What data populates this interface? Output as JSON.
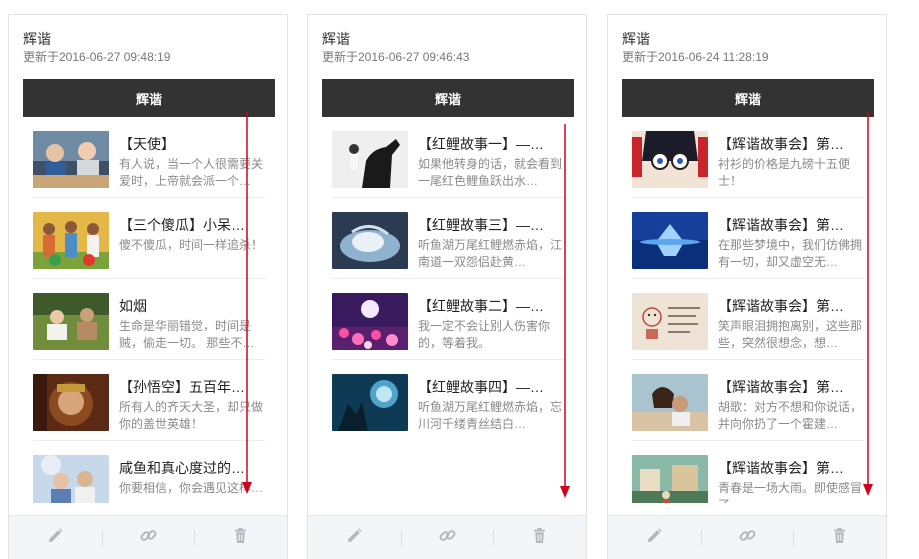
{
  "cards": [
    {
      "title": "辉谐",
      "updated": "更新于2016-06-27 09:48:19",
      "cover_title": "辉谐",
      "articles": [
        {
          "title": "【天使】",
          "desc": "有人说，当一个人很需要关爱时，上帝就会派一个…"
        },
        {
          "title": "【三个傻瓜】小呆…",
          "desc": "傻不傻瓜，时间一样追杀！"
        },
        {
          "title": "如烟",
          "desc": "生命是华丽错觉，时间是贼，偷走一切。 那些不…"
        },
        {
          "title": "【孙悟空】五百年…",
          "desc": "所有人的齐天大圣，却只做你的盖世英雄！"
        },
        {
          "title": "咸鱼和真心度过的…",
          "desc": "你要相信，你会遇见这样…"
        }
      ]
    },
    {
      "title": "辉谐",
      "updated": "更新于2016-06-27 09:46:43",
      "cover_title": "辉谐",
      "articles": [
        {
          "title": "【红鲤故事一】—…",
          "desc": "如果他转身的话，就会看到一尾红色鲤鱼跃出水…"
        },
        {
          "title": "【红鲤故事三】—…",
          "desc": "听鱼湖万尾红鲤燃赤焰，江南道一双怨侣赴黄…"
        },
        {
          "title": "【红鲤故事二】—…",
          "desc": "我一定不会让别人伤害你的，等着我。"
        },
        {
          "title": "【红鲤故事四】—…",
          "desc": "听鱼湖万尾红鲤燃赤焰，忘川河千缕青丝结白…"
        }
      ]
    },
    {
      "title": "辉谐",
      "updated": "更新于2016-06-24 11:28:19",
      "cover_title": "辉谐",
      "articles": [
        {
          "title": "【辉谐故事会】第…",
          "desc": "衬衫的价格是九磅十五便士！"
        },
        {
          "title": "【辉谐故事会】第…",
          "desc": "在那些梦境中，我们仿佛拥有一切，却又虚空无…"
        },
        {
          "title": "【辉谐故事会】第…",
          "desc": "笑声眼泪拥抱离别，这些那些，突然很想念，想…"
        },
        {
          "title": "【辉谐故事会】第…",
          "desc": "胡歌：对方不想和你说话，并向你扔了一个霍建…"
        },
        {
          "title": "【辉谐故事会】第…",
          "desc": "青春是一场大雨。即使感冒了…"
        }
      ]
    }
  ],
  "action_icons": [
    "pencil-icon",
    "link-icon",
    "trash-icon"
  ],
  "colors": {
    "cover_bar": "#333333",
    "arrow": "#d0021b",
    "action_bar": "#f4f5f9",
    "icon": "#b5b7bd"
  }
}
